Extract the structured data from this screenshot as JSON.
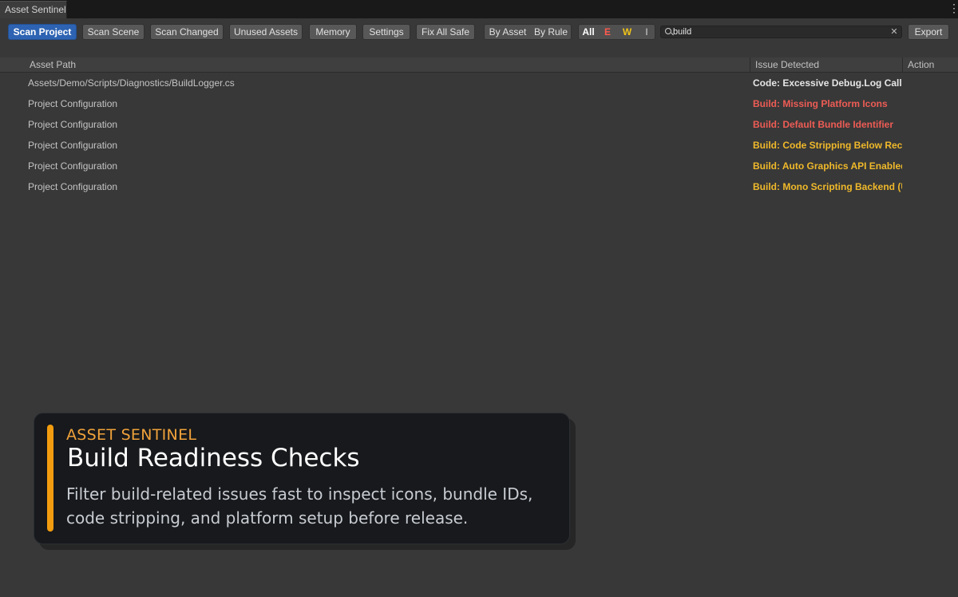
{
  "window": {
    "tab_title": "Asset Sentinel",
    "menu_icon": "kebab-menu-icon"
  },
  "toolbar": {
    "buttons": [
      {
        "label": "Scan Project",
        "active": true
      },
      {
        "label": "Scan Scene"
      },
      {
        "label": "Scan Changed"
      },
      {
        "label": "Unused Assets"
      },
      {
        "label": "Memory"
      },
      {
        "label": "Settings"
      },
      {
        "label": "Fix All Safe"
      }
    ],
    "group_modes": [
      "By Asset",
      "By Rule"
    ],
    "severity_filters": [
      {
        "label": "All",
        "color": "#ffffff"
      },
      {
        "label": "E",
        "color": "#ff5a4f"
      },
      {
        "label": "W",
        "color": "#f0c419"
      },
      {
        "label": "I",
        "color": "#a8a8a8"
      }
    ],
    "search": {
      "value": "build",
      "icon": "search-icon",
      "clear_icon": "close-icon"
    },
    "export_label": "Export"
  },
  "table": {
    "columns": [
      "Asset Path",
      "Issue Detected",
      "Action"
    ],
    "rows": [
      {
        "path": "Assets/Demo/Scripts/Diagnostics/BuildLogger.cs",
        "issue": "Code: Excessive Debug.Log Calls",
        "severity": "info",
        "color": "#e6e6e6"
      },
      {
        "path": "Project Configuration",
        "issue": "Build: Missing Platform Icons",
        "severity": "error",
        "color": "#ee5c55"
      },
      {
        "path": "Project Configuration",
        "issue": "Build: Default Bundle Identifier",
        "severity": "error",
        "color": "#ee5c55"
      },
      {
        "path": "Project Configuration",
        "issue": "Build: Code Stripping Below Recomm",
        "severity": "warning",
        "color": "#f0b92a"
      },
      {
        "path": "Project Configuration",
        "issue": "Build: Auto Graphics API Enabled",
        "severity": "warning",
        "color": "#f0b92a"
      },
      {
        "path": "Project Configuration",
        "issue": "Build: Mono Scripting Backend (Use I",
        "severity": "warning",
        "color": "#f0b92a"
      }
    ]
  },
  "callout": {
    "kicker": "ASSET SENTINEL",
    "title": "Build Readiness Checks",
    "body": "Filter build-related issues fast to inspect icons, bundle IDs, code stripping, and platform setup before release.",
    "accent": "#f29c0f"
  }
}
